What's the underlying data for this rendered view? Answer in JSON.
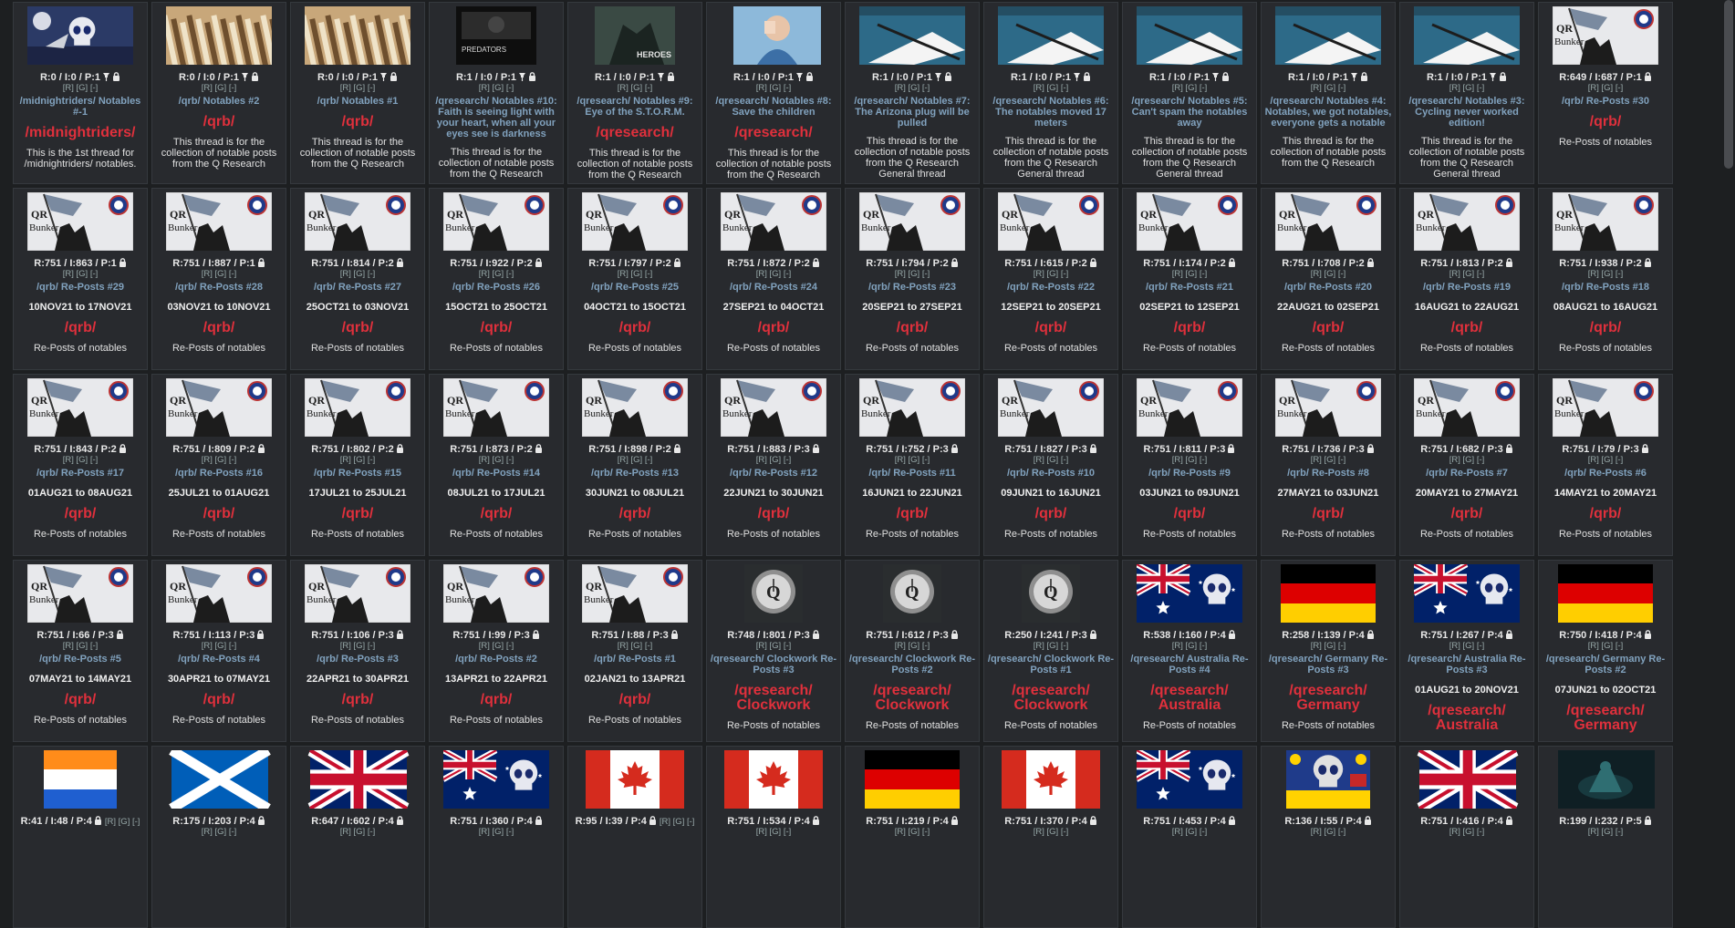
{
  "catalog": {
    "cards": [
      {
        "thumb": "punisher-eagle-image",
        "stats": "R:0 / I:0 / P:1",
        "pinned": true,
        "locked": true,
        "title": "/midnightriders/ Notables #-1",
        "board": "/midnightriders/",
        "desc": "This is the 1st thread for /midnightriders/ notables."
      },
      {
        "thumb": "books-image",
        "stats": "R:0 / I:0 / P:1",
        "pinned": true,
        "locked": true,
        "title": "/qrb/ Notables #2",
        "board": "/qrb/",
        "desc": "This thread is for the collection of notable posts from the Q Research"
      },
      {
        "thumb": "books-image",
        "stats": "R:0 / I:0 / P:1",
        "pinned": true,
        "locked": true,
        "title": "/qrb/ Notables #1",
        "board": "/qrb/",
        "desc": "This thread is for the collection of notable posts from the Q Research"
      },
      {
        "thumb": "predators-image",
        "thumb_text": "PREDATORS",
        "stats": "R:1 / I:0 / P:1",
        "pinned": true,
        "locked": true,
        "title": "/qresearch/ Notables #10: Faith is seeing light with your heart, when all your eyes see is darkness",
        "desc": "This thread is for the collection of notable posts from the Q Research"
      },
      {
        "thumb": "heroes-image",
        "thumb_text": "HEROES",
        "stats": "R:1 / I:0 / P:1",
        "pinned": true,
        "locked": true,
        "title": "/qresearch/ Notables #9: Eye of the S.T.O.R.M.",
        "board": "/qresearch/",
        "desc": "This thread is for the collection of notable posts from the Q Research"
      },
      {
        "thumb": "child-image",
        "stats": "R:1 / I:0 / P:1",
        "pinned": true,
        "locked": true,
        "title": "/qresearch/ Notables #8: Save the children",
        "board": "/qresearch/",
        "desc": "This thread is for the collection of notable posts from the Q Research"
      },
      {
        "thumb": "notebook-image",
        "stats": "R:1 / I:0 / P:1",
        "pinned": true,
        "locked": true,
        "title": "/qresearch/ Notables #7: The Arizona plug will be pulled",
        "desc": "This thread is for the collection of notable posts from the Q Research General thread"
      },
      {
        "thumb": "notebook-image",
        "stats": "R:1 / I:0 / P:1",
        "pinned": true,
        "locked": true,
        "title": "/qresearch/ Notables #6: The notables moved 17 meters",
        "desc": "This thread is for the collection of notable posts from the Q Research General thread"
      },
      {
        "thumb": "notebook-image",
        "stats": "R:1 / I:0 / P:1",
        "pinned": true,
        "locked": true,
        "title": "/qresearch/ Notables #5: Can't spam the notables away",
        "desc": "This thread is for the collection of notable posts from the Q Research General thread"
      },
      {
        "thumb": "notebook-image",
        "stats": "R:1 / I:0 / P:1",
        "pinned": true,
        "locked": true,
        "title": "/qresearch/ Notables #4: Notables, we got notables, everyone gets a notable",
        "desc": "This thread is for the collection of notable posts from the Q Research"
      },
      {
        "thumb": "notebook-image",
        "stats": "R:1 / I:0 / P:1",
        "pinned": true,
        "locked": true,
        "title": "/qresearch/ Notables #3: Cycling never worked edition!",
        "desc": "This thread is for the collection of notable posts from the Q Research General thread"
      },
      {
        "thumb": "qr-bunker-image",
        "stats": "R:649 / I:687 / P:1",
        "pinned": false,
        "locked": true,
        "title": "/qrb/ Re-Posts #30",
        "board": "/qrb/",
        "desc": "Re-Posts of notables"
      },
      {
        "thumb": "qr-bunker-image",
        "stats": "R:751 / I:863 / P:1",
        "locked": true,
        "title": "/qrb/ Re-Posts #29",
        "dates": "10NOV21 to 17NOV21",
        "board": "/qrb/",
        "desc": "Re-Posts of notables"
      },
      {
        "thumb": "qr-bunker-image",
        "stats": "R:751 / I:887 / P:1",
        "locked": true,
        "title": "/qrb/ Re-Posts #28",
        "dates": "03NOV21 to 10NOV21",
        "board": "/qrb/",
        "desc": "Re-Posts of notables"
      },
      {
        "thumb": "qr-bunker-image",
        "stats": "R:751 / I:814 / P:2",
        "locked": true,
        "title": "/qrb/ Re-Posts #27",
        "dates": "25OCT21 to 03NOV21",
        "board": "/qrb/",
        "desc": "Re-Posts of notables"
      },
      {
        "thumb": "qr-bunker-image",
        "stats": "R:751 / I:922 / P:2",
        "locked": true,
        "title": "/qrb/ Re-Posts #26",
        "dates": "15OCT21 to 25OCT21",
        "board": "/qrb/",
        "desc": "Re-Posts of notables"
      },
      {
        "thumb": "qr-bunker-image",
        "stats": "R:751 / I:797 / P:2",
        "locked": true,
        "title": "/qrb/ Re-Posts #25",
        "dates": "04OCT21 to 15OCT21",
        "board": "/qrb/",
        "desc": "Re-Posts of notables"
      },
      {
        "thumb": "qr-bunker-image",
        "stats": "R:751 / I:872 / P:2",
        "locked": true,
        "title": "/qrb/ Re-Posts #24",
        "dates": "27SEP21 to 04OCT21",
        "board": "/qrb/",
        "desc": "Re-Posts of notables"
      },
      {
        "thumb": "qr-bunker-image",
        "stats": "R:751 / I:794 / P:2",
        "locked": true,
        "title": "/qrb/ Re-Posts #23",
        "dates": "20SEP21 to 27SEP21",
        "board": "/qrb/",
        "desc": "Re-Posts of notables"
      },
      {
        "thumb": "qr-bunker-image",
        "stats": "R:751 / I:615 / P:2",
        "locked": true,
        "title": "/qrb/ Re-Posts #22",
        "dates": "12SEP21 to 20SEP21",
        "board": "/qrb/",
        "desc": "Re-Posts of notables"
      },
      {
        "thumb": "qr-bunker-image",
        "stats": "R:751 / I:174 / P:2",
        "locked": true,
        "title": "/qrb/ Re-Posts #21",
        "dates": "02SEP21 to 12SEP21",
        "board": "/qrb/",
        "desc": "Re-Posts of notables"
      },
      {
        "thumb": "qr-bunker-image",
        "stats": "R:751 / I:708 / P:2",
        "locked": true,
        "title": "/qrb/ Re-Posts #20",
        "dates": "22AUG21 to 02SEP21",
        "board": "/qrb/",
        "desc": "Re-Posts of notables"
      },
      {
        "thumb": "qr-bunker-image",
        "stats": "R:751 / I:813 / P:2",
        "locked": true,
        "title": "/qrb/ Re-Posts #19",
        "dates": "16AUG21 to 22AUG21",
        "board": "/qrb/",
        "desc": "Re-Posts of notables"
      },
      {
        "thumb": "qr-bunker-image",
        "stats": "R:751 / I:938 / P:2",
        "locked": true,
        "title": "/qrb/ Re-Posts #18",
        "dates": "08AUG21 to 16AUG21",
        "board": "/qrb/",
        "desc": "Re-Posts of notables"
      },
      {
        "thumb": "qr-bunker-image",
        "stats": "R:751 / I:843 / P:2",
        "locked": true,
        "title": "/qrb/ Re-Posts #17",
        "dates": "01AUG21 to 08AUG21",
        "board": "/qrb/",
        "desc": "Re-Posts of notables"
      },
      {
        "thumb": "qr-bunker-image",
        "stats": "R:751 / I:809 / P:2",
        "locked": true,
        "title": "/qrb/ Re-Posts #16",
        "dates": "25JUL21 to 01AUG21",
        "board": "/qrb/",
        "desc": "Re-Posts of notables"
      },
      {
        "thumb": "qr-bunker-image",
        "stats": "R:751 / I:802 / P:2",
        "locked": true,
        "title": "/qrb/ Re-Posts #15",
        "dates": "17JUL21 to 25JUL21",
        "board": "/qrb/",
        "desc": "Re-Posts of notables"
      },
      {
        "thumb": "qr-bunker-image",
        "stats": "R:751 / I:873 / P:2",
        "locked": true,
        "title": "/qrb/ Re-Posts #14",
        "dates": "08JUL21 to 17JUL21",
        "board": "/qrb/",
        "desc": "Re-Posts of notables"
      },
      {
        "thumb": "qr-bunker-image",
        "stats": "R:751 / I:898 / P:2",
        "locked": true,
        "title": "/qrb/ Re-Posts #13",
        "dates": "30JUN21 to 08JUL21",
        "board": "/qrb/",
        "desc": "Re-Posts of notables"
      },
      {
        "thumb": "qr-bunker-image",
        "stats": "R:751 / I:883 / P:3",
        "locked": true,
        "title": "/qrb/ Re-Posts #12",
        "dates": "22JUN21 to 30JUN21",
        "board": "/qrb/",
        "desc": "Re-Posts of notables"
      },
      {
        "thumb": "qr-bunker-image",
        "stats": "R:751 / I:752 / P:3",
        "locked": true,
        "title": "/qrb/ Re-Posts #11",
        "dates": "16JUN21 to 22JUN21",
        "board": "/qrb/",
        "desc": "Re-Posts of notables"
      },
      {
        "thumb": "qr-bunker-image",
        "stats": "R:751 / I:827 / P:3",
        "locked": true,
        "title": "/qrb/ Re-Posts #10",
        "dates": "09JUN21 to 16JUN21",
        "board": "/qrb/",
        "desc": "Re-Posts of notables"
      },
      {
        "thumb": "qr-bunker-image",
        "stats": "R:751 / I:811 / P:3",
        "locked": true,
        "title": "/qrb/ Re-Posts #9",
        "dates": "03JUN21 to 09JUN21",
        "board": "/qrb/",
        "desc": "Re-Posts of notables"
      },
      {
        "thumb": "qr-bunker-image",
        "stats": "R:751 / I:736 / P:3",
        "locked": true,
        "title": "/qrb/ Re-Posts #8",
        "dates": "27MAY21 to 03JUN21",
        "board": "/qrb/",
        "desc": "Re-Posts of notables"
      },
      {
        "thumb": "qr-bunker-image",
        "stats": "R:751 / I:682 / P:3",
        "locked": true,
        "title": "/qrb/ Re-Posts #7",
        "dates": "20MAY21 to 27MAY21",
        "board": "/qrb/",
        "desc": "Re-Posts of notables"
      },
      {
        "thumb": "qr-bunker-image",
        "stats": "R:751 / I:79 / P:3",
        "locked": true,
        "title": "/qrb/ Re-Posts #6",
        "dates": "14MAY21 to 20MAY21",
        "board": "/qrb/",
        "desc": "Re-Posts of notables"
      },
      {
        "thumb": "qr-bunker-image",
        "stats": "R:751 / I:66 / P:3",
        "locked": true,
        "title": "/qrb/ Re-Posts #5",
        "dates": "07MAY21 to 14MAY21",
        "board": "/qrb/",
        "desc": "Re-Posts of notables"
      },
      {
        "thumb": "qr-bunker-image",
        "stats": "R:751 / I:113 / P:3",
        "locked": true,
        "title": "/qrb/ Re-Posts #4",
        "dates": "30APR21 to 07MAY21",
        "board": "/qrb/",
        "desc": "Re-Posts of notables"
      },
      {
        "thumb": "qr-bunker-image",
        "stats": "R:751 / I:106 / P:3",
        "locked": true,
        "title": "/qrb/ Re-Posts #3",
        "dates": "22APR21 to 30APR21",
        "board": "/qrb/",
        "desc": "Re-Posts of notables"
      },
      {
        "thumb": "qr-bunker-image",
        "stats": "R:751 / I:99 / P:3",
        "locked": true,
        "title": "/qrb/ Re-Posts #2",
        "dates": "13APR21 to 22APR21",
        "board": "/qrb/",
        "desc": "Re-Posts of notables"
      },
      {
        "thumb": "qr-bunker-image",
        "stats": "R:751 / I:88 / P:3",
        "locked": true,
        "title": "/qrb/ Re-Posts #1",
        "dates": "02JAN21 to 13APR21",
        "board": "/qrb/",
        "desc": "Re-Posts of notables"
      },
      {
        "thumb": "clockwork-q-image",
        "stats": "R:748 / I:801 / P:3",
        "locked": true,
        "title": "/qresearch/ Clockwork Re-Posts #3",
        "board": "/qresearch/ Clockwork",
        "desc": "Re-Posts of notables"
      },
      {
        "thumb": "clockwork-q-image",
        "stats": "R:751 / I:612 / P:3",
        "locked": true,
        "title": "/qresearch/ Clockwork Re-Posts #2",
        "board": "/qresearch/ Clockwork",
        "desc": "Re-Posts of notables"
      },
      {
        "thumb": "clockwork-q-image",
        "stats": "R:250 / I:241 / P:3",
        "locked": true,
        "title": "/qresearch/ Clockwork Re-Posts #1",
        "board": "/qresearch/ Clockwork",
        "desc": "Re-Posts of notables"
      },
      {
        "thumb": "australia-flag-image",
        "stats": "R:538 / I:160 / P:4",
        "locked": true,
        "title": "/qresearch/ Australia Re-Posts #4",
        "board": "/qresearch/ Australia",
        "desc": "Re-Posts of notables"
      },
      {
        "thumb": "germany-flag-image",
        "stats": "R:258 / I:139 / P:4",
        "locked": true,
        "title": "/qresearch/ Germany Re-Posts #3",
        "board": "/qresearch/ Germany",
        "desc": "Re-Posts of notables"
      },
      {
        "thumb": "australia-flag-image",
        "stats": "R:751 / I:267 / P:4",
        "locked": true,
        "title": "/qresearch/ Australia Re-Posts #3",
        "dates": "01AUG21 to 20NOV21",
        "board": "/qresearch/ Australia",
        "desc": ""
      },
      {
        "thumb": "germany-flag-image",
        "stats": "R:750 / I:418 / P:4",
        "locked": true,
        "title": "/qresearch/ Germany Re-Posts #2",
        "dates": "07JUN21 to 02OCT21",
        "board": "/qresearch/ Germany",
        "desc": ""
      },
      {
        "thumb": "orange-white-blue-flag-image",
        "stats": "R:41 / I:48 / P:4",
        "locked": true,
        "inline_rgx": true
      },
      {
        "thumb": "scotland-flag-image",
        "stats": "R:175 / I:203 / P:4",
        "locked": true
      },
      {
        "thumb": "uk-flag-image",
        "stats": "R:647 / I:602 / P:4",
        "locked": true
      },
      {
        "thumb": "australia-flag-image",
        "stats": "R:751 / I:360 / P:4",
        "locked": true
      },
      {
        "thumb": "canada-flag-image",
        "stats": "R:95 / I:39 / P:4",
        "locked": true,
        "inline_rgx": true
      },
      {
        "thumb": "canada-flag-image",
        "stats": "R:751 / I:534 / P:4",
        "locked": true
      },
      {
        "thumb": "germany-flag-image",
        "stats": "R:751 / I:219 / P:4",
        "locked": true
      },
      {
        "thumb": "canada-flag-image",
        "stats": "R:751 / I:370 / P:4",
        "locked": true
      },
      {
        "thumb": "australia-flag-image",
        "stats": "R:751 / I:453 / P:4",
        "locked": true
      },
      {
        "thumb": "skull-emblem-image",
        "stats": "R:136 / I:55 / P:4",
        "locked": true
      },
      {
        "thumb": "uk-flag-image",
        "stats": "R:751 / I:416 / P:4",
        "locked": true
      },
      {
        "thumb": "dark-soldier-image",
        "stats": "R:199 / I:232 / P:5",
        "locked": true
      }
    ]
  },
  "links": {
    "r": "[R]",
    "g": "[G]",
    "x": "[-]"
  },
  "colors": {
    "background": "#1d1f21",
    "card": "#282a2e",
    "title_link": "#81a2be",
    "board_red": "#e0303c"
  }
}
